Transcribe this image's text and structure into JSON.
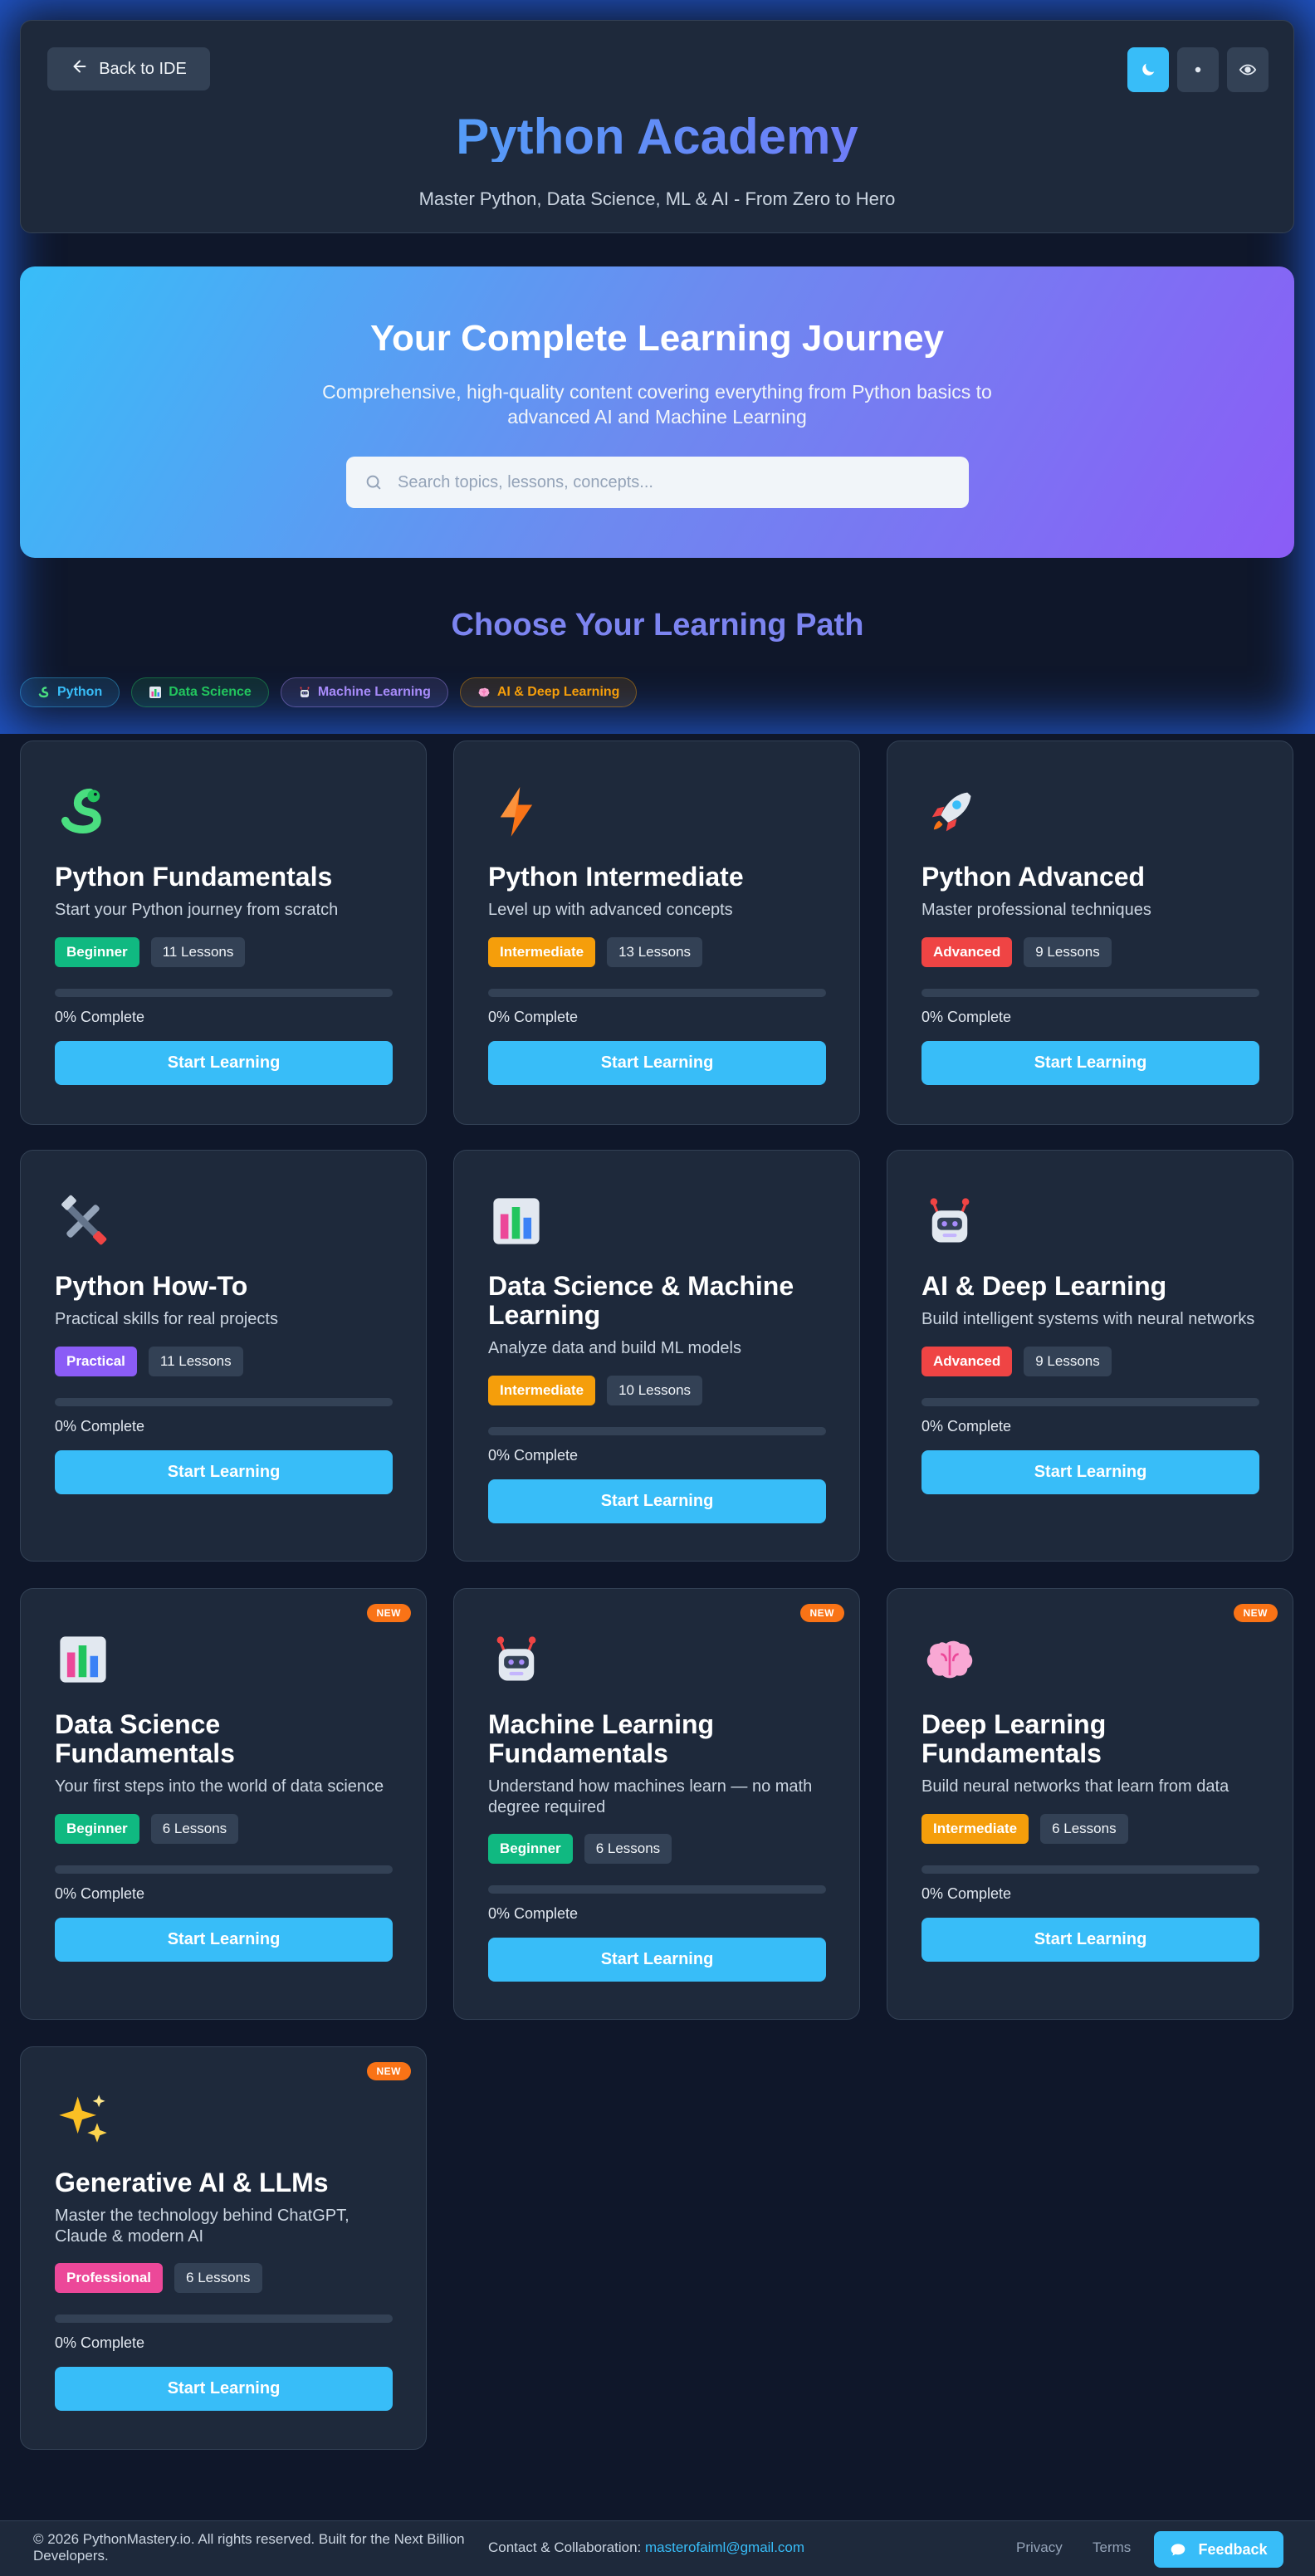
{
  "header": {
    "back_label": "Back to IDE",
    "title": "Python Academy",
    "subtitle": "Master Python, Data Science, ML & AI - From Zero to Hero"
  },
  "hero": {
    "title": "Your Complete Learning Journey",
    "subtitle": "Comprehensive, high-quality content covering everything from Python basics to advanced AI and Machine Learning",
    "search_placeholder": "Search topics, lessons, concepts..."
  },
  "paths": {
    "title": "Choose Your Learning Path",
    "chips": [
      {
        "label": "Python",
        "icon": "snake-icon",
        "color": "#38bdf8"
      },
      {
        "label": "Data Science",
        "icon": "chart-icon",
        "color": "#22c55e"
      },
      {
        "label": "Machine Learning",
        "icon": "robot-icon",
        "color": "#a78bfa"
      },
      {
        "label": "AI & Deep Learning",
        "icon": "brain-icon",
        "color": "#f59e0b"
      }
    ]
  },
  "colors": {
    "accent": "#38bdf8",
    "beginner": "#10b981",
    "intermediate": "#f59e0b",
    "advanced": "#ef4444",
    "practical": "#8b5cf6",
    "professional": "#ec4899",
    "new": "#f97316"
  },
  "courses": [
    {
      "title": "Python Fundamentals",
      "desc": "Start your Python journey from scratch",
      "level": "Beginner",
      "lessons": "11 Lessons",
      "progress_pct": 0,
      "progress_text": "0% Complete",
      "button": "Start Learning",
      "icon": "snake-icon",
      "new": ""
    },
    {
      "title": "Python Intermediate",
      "desc": "Level up with advanced concepts",
      "level": "Intermediate",
      "lessons": "13 Lessons",
      "progress_pct": 0,
      "progress_text": "0% Complete",
      "button": "Start Learning",
      "icon": "lightning-icon",
      "new": ""
    },
    {
      "title": "Python Advanced",
      "desc": "Master professional techniques",
      "level": "Advanced",
      "lessons": "9 Lessons",
      "progress_pct": 0,
      "progress_text": "0% Complete",
      "button": "Start Learning",
      "icon": "rocket-icon",
      "new": ""
    },
    {
      "title": "Python How-To",
      "desc": "Practical skills for real projects",
      "level": "Practical",
      "lessons": "11 Lessons",
      "progress_pct": 0,
      "progress_text": "0% Complete",
      "button": "Start Learning",
      "icon": "tools-icon",
      "new": ""
    },
    {
      "title": "Data Science & Machine Learning",
      "desc": "Analyze data and build ML models",
      "level": "Intermediate",
      "lessons": "10 Lessons",
      "progress_pct": 0,
      "progress_text": "0% Complete",
      "button": "Start Learning",
      "icon": "bar-chart-icon",
      "new": ""
    },
    {
      "title": "AI & Deep Learning",
      "desc": "Build intelligent systems with neural networks",
      "level": "Advanced",
      "lessons": "9 Lessons",
      "progress_pct": 0,
      "progress_text": "0% Complete",
      "button": "Start Learning",
      "icon": "robot-icon",
      "new": ""
    },
    {
      "title": "Data Science Fundamentals",
      "desc": "Your first steps into the world of data science",
      "level": "Beginner",
      "lessons": "6 Lessons",
      "progress_pct": 0,
      "progress_text": "0% Complete",
      "button": "Start Learning",
      "icon": "bar-chart-icon",
      "new": "NEW"
    },
    {
      "title": "Machine Learning Fundamentals",
      "desc": "Understand how machines learn — no math degree required",
      "level": "Beginner",
      "lessons": "6 Lessons",
      "progress_pct": 0,
      "progress_text": "0% Complete",
      "button": "Start Learning",
      "icon": "robot-icon",
      "new": "NEW"
    },
    {
      "title": "Deep Learning Fundamentals",
      "desc": "Build neural networks that learn from data",
      "level": "Intermediate",
      "lessons": "6 Lessons",
      "progress_pct": 0,
      "progress_text": "0% Complete",
      "button": "Start Learning",
      "icon": "brain-icon",
      "new": "NEW"
    },
    {
      "title": "Generative AI & LLMs",
      "desc": "Master the technology behind ChatGPT, Claude & modern AI",
      "level": "Professional",
      "lessons": "6 Lessons",
      "progress_pct": 0,
      "progress_text": "0% Complete",
      "button": "Start Learning",
      "icon": "sparkles-icon",
      "new": "NEW"
    }
  ],
  "footer": {
    "copyright": "© 2026 PythonMastery.io. All rights reserved. Built for the Next Billion Developers.",
    "contact_label": "Contact & Collaboration:",
    "contact_email": "masterofaiml@gmail.com",
    "privacy": "Privacy",
    "terms": "Terms",
    "feedback": "Feedback"
  }
}
